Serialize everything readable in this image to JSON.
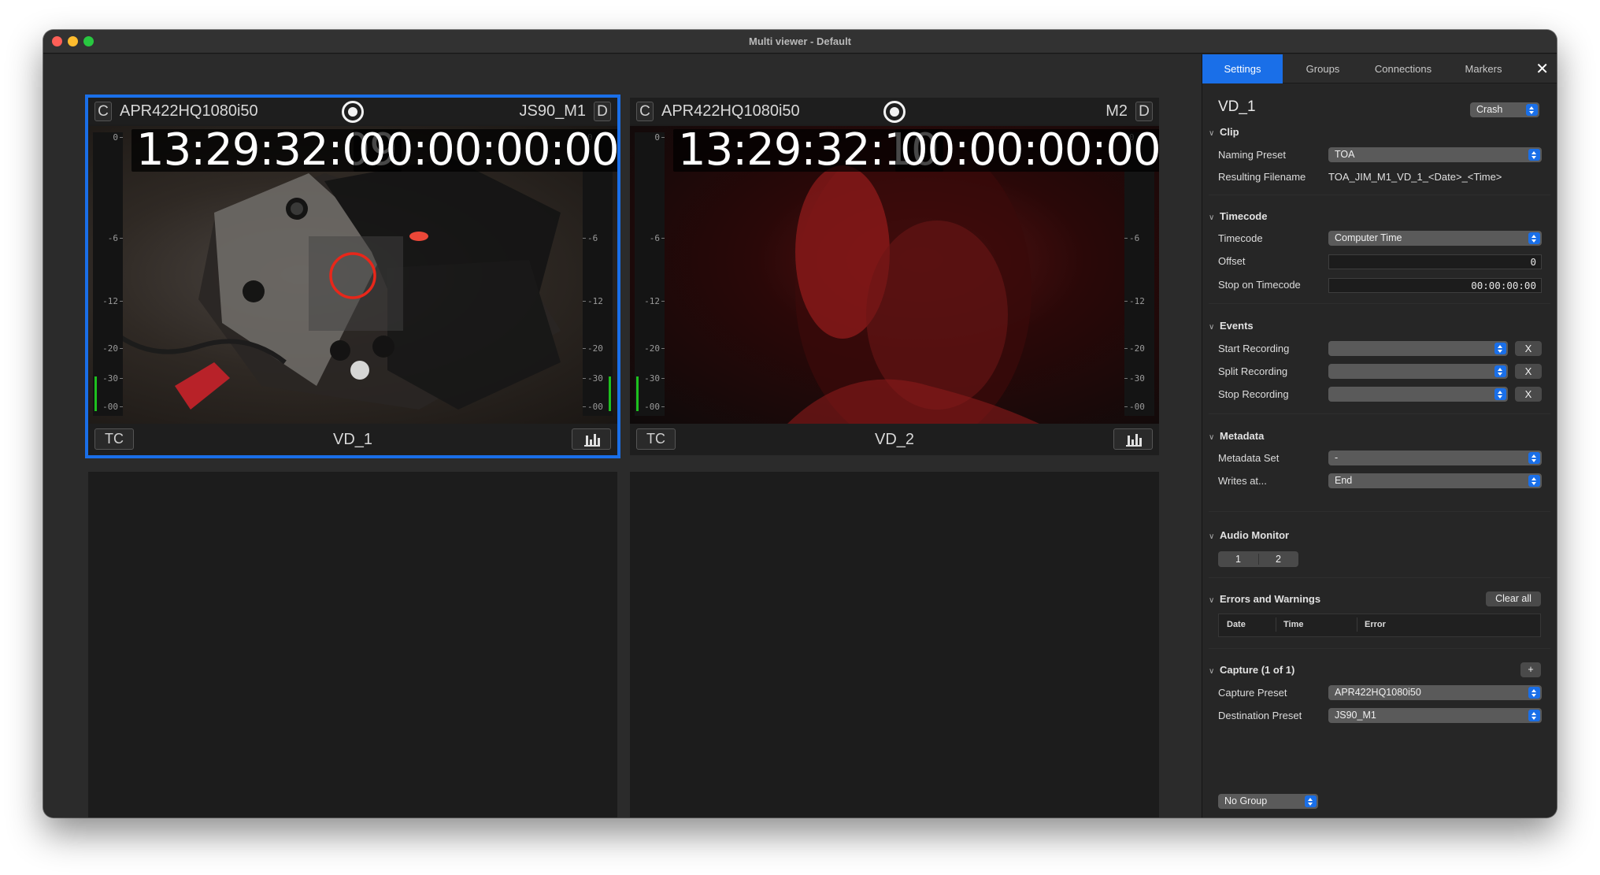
{
  "window": {
    "title": "Multi viewer - Default"
  },
  "viewers": [
    {
      "preset": "APR422HQ1080i50",
      "destination": "JS90_M1",
      "badge_left": "C",
      "badge_right": "D",
      "timecode": "13:29:32:09",
      "duration": "00:00:00:00",
      "clip_name": "VD_1",
      "tc_label": "TC",
      "meter_ticks": [
        "0",
        "-6",
        "-12",
        "-20",
        "-30",
        "-00"
      ]
    },
    {
      "preset": "APR422HQ1080i50",
      "destination": "M2",
      "badge_left": "C",
      "badge_right": "D",
      "timecode": "13:29:32:10",
      "duration": "00:00:00:00",
      "clip_name": "VD_2",
      "tc_label": "TC",
      "meter_ticks": [
        "0",
        "-6",
        "-12",
        "-20",
        "-30",
        "-00"
      ]
    }
  ],
  "sidebar": {
    "tabs": [
      "Settings",
      "Groups",
      "Connections",
      "Markers"
    ],
    "close": "✕",
    "title": "VD_1",
    "mode_popup": "Crash",
    "clip": {
      "header": "Clip",
      "naming_preset_label": "Naming Preset",
      "naming_preset_value": "TOA",
      "resulting_filename_label": "Resulting Filename",
      "resulting_filename_value": "TOA_JIM_M1_VD_1_<Date>_<Time>"
    },
    "timecode": {
      "header": "Timecode",
      "timecode_label": "Timecode",
      "timecode_value": "Computer Time",
      "offset_label": "Offset",
      "offset_value": "0",
      "stop_label": "Stop on Timecode",
      "stop_value": "00:00:00:00"
    },
    "events": {
      "header": "Events",
      "start_label": "Start Recording",
      "split_label": "Split Recording",
      "stop_label": "Stop Recording",
      "clear_label": "X"
    },
    "metadata": {
      "header": "Metadata",
      "set_label": "Metadata Set",
      "set_value": "-",
      "writes_label": "Writes at...",
      "writes_value": "End"
    },
    "audio_monitor": {
      "header": "Audio Monitor",
      "channels": [
        "1",
        "2"
      ]
    },
    "errors": {
      "header": "Errors and Warnings",
      "clear_all": "Clear all",
      "columns": [
        "Date",
        "Time",
        "Error"
      ]
    },
    "capture": {
      "header": "Capture (1 of 1)",
      "add": "+",
      "preset_label": "Capture Preset",
      "preset_value": "APR422HQ1080i50",
      "destination_label": "Destination Preset",
      "destination_value": "JS90_M1"
    },
    "group_popup": "No Group"
  },
  "colors": {
    "accent": "#1a6fe8",
    "meter_green": "#1ec01e"
  }
}
